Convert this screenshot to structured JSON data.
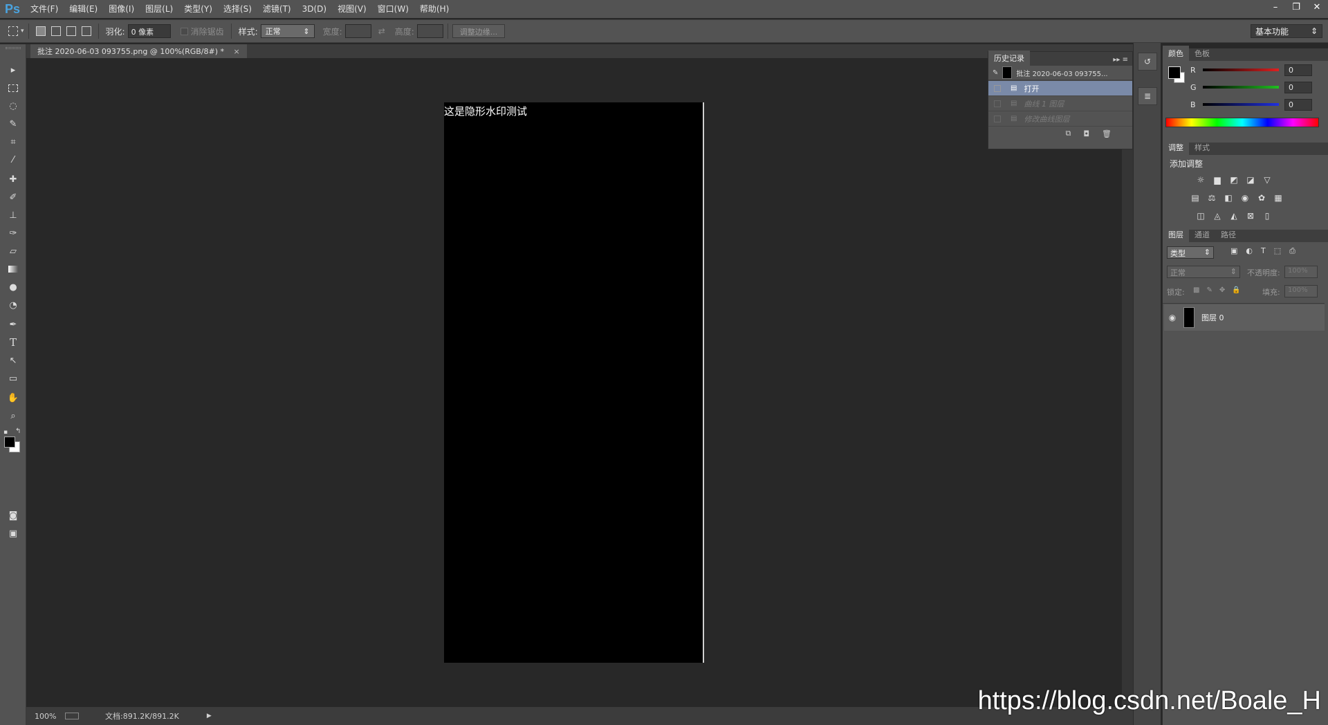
{
  "app": {
    "logo": "Ps"
  },
  "menu": [
    "文件(F)",
    "编辑(E)",
    "图像(I)",
    "图层(L)",
    "类型(Y)",
    "选择(S)",
    "滤镜(T)",
    "3D(D)",
    "视图(V)",
    "窗口(W)",
    "帮助(H)"
  ],
  "window_controls": {
    "minimize": "–",
    "restore": "❐",
    "close": "✕"
  },
  "options_bar": {
    "feather_label": "羽化:",
    "feather_value": "0 像素",
    "antialias_label": "消除锯齿",
    "style_label": "样式:",
    "style_value": "正常",
    "width_label": "宽度:",
    "height_label": "高度:",
    "refine_edge_button": "调整边缘...",
    "workspace": "基本功能"
  },
  "document": {
    "tab_title": "批注 2020-06-03 093755.png @ 100%(RGB/8#) *",
    "close": "×",
    "image_text": "这是隐形水印测试"
  },
  "status_bar": {
    "zoom": "100%",
    "doc_size": "文档:891.2K/891.2K"
  },
  "history_panel": {
    "tab": "历史记录",
    "snapshot_label": "批注 2020-06-03 093755...",
    "items": [
      {
        "label": "打开",
        "state": "active"
      },
      {
        "label": "曲线 1 图层",
        "state": "dimmed"
      },
      {
        "label": "修改曲线图层",
        "state": "dimmed"
      }
    ]
  },
  "color_panel": {
    "tabs": [
      "颜色",
      "色板"
    ],
    "channels": [
      {
        "label": "R",
        "value": "0"
      },
      {
        "label": "G",
        "value": "0"
      },
      {
        "label": "B",
        "value": "0"
      }
    ],
    "colors": {
      "r": "#e02020",
      "g": "#20c020",
      "b": "#2030e0"
    }
  },
  "adjustments_panel": {
    "tabs": [
      "调整",
      "样式"
    ],
    "title": "添加调整",
    "icons_row1": [
      "brightness-icon",
      "levels-icon",
      "curves-icon",
      "exposure-icon",
      "vibrance-icon"
    ],
    "icons_row2": [
      "hue-sat-icon",
      "color-balance-icon",
      "black-white-icon",
      "photo-filter-icon",
      "channel-mixer-icon",
      "color-lookup-icon"
    ],
    "icons_row3": [
      "invert-icon",
      "posterize-icon",
      "threshold-icon",
      "selective-color-icon",
      "gradient-map-icon"
    ]
  },
  "layers_panel": {
    "tabs": [
      "图层",
      "通道",
      "路径"
    ],
    "filter_kind": "类型",
    "blend_mode": "正常",
    "opacity_label": "不透明度:",
    "opacity_value": "100%",
    "lock_label": "锁定:",
    "fill_label": "填充:",
    "fill_value": "100%",
    "layers": [
      {
        "name": "图层 0"
      }
    ]
  },
  "overlay": {
    "site_watermark": "https://blog.csdn.net/Boale_H"
  }
}
